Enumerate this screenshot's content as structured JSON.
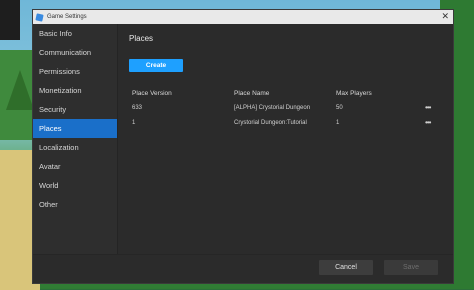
{
  "window": {
    "title": "Game Settings",
    "close_glyph": "✕"
  },
  "sidebar": {
    "items": [
      {
        "label": "Basic Info"
      },
      {
        "label": "Communication"
      },
      {
        "label": "Permissions"
      },
      {
        "label": "Monetization"
      },
      {
        "label": "Security"
      },
      {
        "label": "Places",
        "active": true
      },
      {
        "label": "Localization"
      },
      {
        "label": "Avatar"
      },
      {
        "label": "World"
      },
      {
        "label": "Other"
      }
    ]
  },
  "main": {
    "heading": "Places",
    "create_label": "Create",
    "columns": [
      "Place Version",
      "Place Name",
      "Max Players"
    ],
    "rows": [
      {
        "version": "633",
        "name": "[ALPHA] Crystorial Dungeon",
        "max_players": "50",
        "more": "•••"
      },
      {
        "version": "1",
        "name": "Crystorial Dungeon:Tutorial",
        "max_players": "1",
        "more": "•••"
      }
    ]
  },
  "footer": {
    "cancel_label": "Cancel",
    "save_label": "Save"
  },
  "colors": {
    "accent": "#1ea0ff",
    "selected": "#1a6fc9",
    "panel": "#2b2b2b"
  }
}
